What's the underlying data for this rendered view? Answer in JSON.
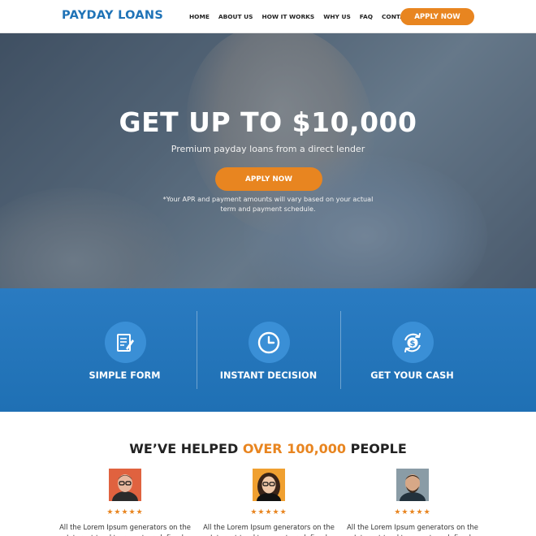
{
  "header": {
    "logo": "PAYDAY LOANS",
    "nav": [
      "HOME",
      "ABOUT US",
      "HOW IT WORKS",
      "WHY US",
      "FAQ",
      "CONTACT US"
    ],
    "apply_label": "APPLY NOW"
  },
  "hero": {
    "title": "GET UP TO $10,000",
    "subtitle": "Premium payday loans from a direct lender",
    "apply_label": "APPLY NOW",
    "disclaimer": "*Your APR and payment amounts will vary based on your actual term and payment schedule."
  },
  "features": [
    {
      "icon": "form-icon",
      "label": "SIMPLE FORM"
    },
    {
      "icon": "clock-icon",
      "label": "INSTANT DECISION"
    },
    {
      "icon": "cash-icon",
      "label": "GET YOUR CASH"
    }
  ],
  "testimonials": {
    "heading_pre": "WE’VE HELPED ",
    "heading_accent": "OVER 100,000",
    "heading_post": " PEOPLE",
    "cards": [
      {
        "stars": "★★★★★",
        "text": "All the Lorem Ipsum generators on the Internet tend to repeat predefined"
      },
      {
        "stars": "★★★★★",
        "text": "All the Lorem Ipsum generators on the Internet tend to repeat predefined"
      },
      {
        "stars": "★★★★★",
        "text": "All the Lorem Ipsum generators on the Internet tend to repeat predefined"
      }
    ]
  },
  "colors": {
    "brand_blue": "#1f73b7",
    "accent_orange": "#e88520"
  }
}
